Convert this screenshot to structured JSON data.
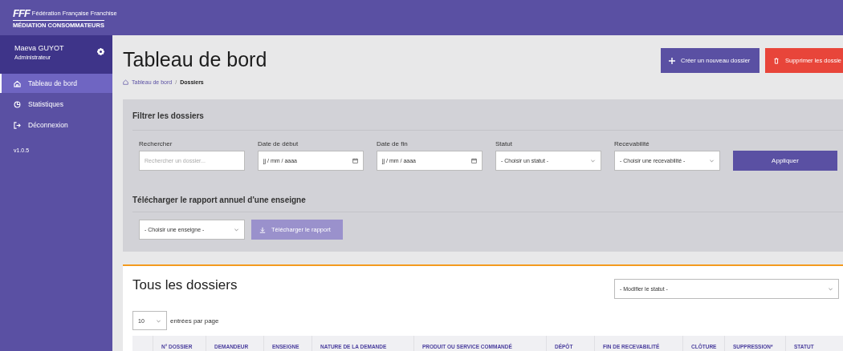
{
  "logo": {
    "mark": "FFF",
    "org": "Fédération Française Franchise",
    "tagline": "MÉDIATION CONSOMMATEURS"
  },
  "user": {
    "name": "Maeva GUYOT",
    "role": "Administrateur"
  },
  "sidebar": {
    "items": [
      {
        "label": "Tableau de bord",
        "selected": true
      },
      {
        "label": "Statistiques",
        "selected": false
      },
      {
        "label": "Déconnexion",
        "selected": false
      }
    ],
    "version": "v1.0.5"
  },
  "page": {
    "title": "Tableau de bord",
    "separator": "/",
    "breadcrumb": [
      {
        "label": "Tableau de bord",
        "current": false
      },
      {
        "label": "Dossiers",
        "current": true
      }
    ],
    "actions": [
      {
        "label": "Créer un nouveau dossier",
        "kind": "create"
      },
      {
        "label": "Supprimer les dossie",
        "kind": "delete"
      }
    ]
  },
  "filters": {
    "title": "Filtrer les dossiers",
    "fields": [
      {
        "label": "Rechercher",
        "kind": "text",
        "placeholder": "Rechercher un dossier..."
      },
      {
        "label": "Date de début",
        "kind": "date",
        "value": "jj / mm / aaaa"
      },
      {
        "label": "Date de fin",
        "kind": "date",
        "value": "jj / mm / aaaa"
      },
      {
        "label": "Statut",
        "kind": "select",
        "value": "- Choisir un statut -"
      },
      {
        "label": "Recevabilité",
        "kind": "select",
        "value": "- Choisir une recevabilité -"
      }
    ],
    "apply": "Appliquer",
    "report_title": "Télécharger le rapport annuel d'une enseigne",
    "report_select": "- Choisir une enseigne -",
    "report_button": "Télécharger le rapport"
  },
  "dossiers": {
    "title": "Tous les dossiers",
    "status_select": "- Modifier le statut -",
    "page_size": "10",
    "page_size_label": "entrées par page",
    "table": {
      "columns": [
        "N° DOSSIER",
        "DEMANDEUR",
        "ENSEIGNE",
        "NATURE DE LA DEMANDE",
        "PRODUIT OU SERVICE COMMANDÉ",
        "DÉPÔT",
        "FIN DE RECEVABILITÉ",
        "CLÔTURE",
        "SUPPRESSION*",
        "STATUT"
      ]
    }
  }
}
